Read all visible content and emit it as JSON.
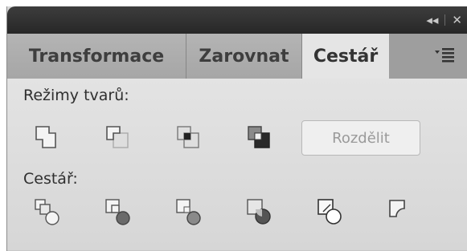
{
  "titlebar": {
    "collapse_glyph": "◂◂",
    "close_glyph": "✕"
  },
  "tabs": [
    {
      "label": "Transformace",
      "active": false
    },
    {
      "label": "Zarovnat",
      "active": false
    },
    {
      "label": "Cestář",
      "active": true
    }
  ],
  "shape_modes": {
    "label": "Režimy tvarů:",
    "divide_button": "Rozdělit",
    "icons": [
      "unite-icon",
      "minus-front-icon",
      "intersect-icon",
      "exclude-icon"
    ]
  },
  "pathfinders": {
    "label": "Cestář:",
    "icons": [
      "divide-icon",
      "trim-icon",
      "merge-icon",
      "crop-icon",
      "outline-icon",
      "minus-back-icon"
    ]
  }
}
